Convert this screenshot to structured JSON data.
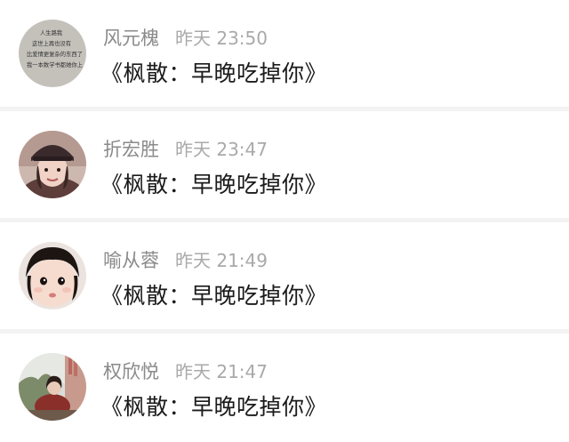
{
  "messages": [
    {
      "name": "风元槐",
      "time": "昨天 23:50",
      "text": "《枫散：早晚吃掉你》",
      "avatar": "text-image-avatar",
      "avatar_lines": [
        "人生路我",
        "这世上再也没有",
        "比爱情更复杂的东西了",
        "我一本数学书都她你上"
      ]
    },
    {
      "name": "折宏胜",
      "time": "昨天 23:47",
      "text": "《枫散：早晚吃掉你》",
      "avatar": "girl-with-cap-avatar"
    },
    {
      "name": "喻从蓉",
      "time": "昨天 21:49",
      "text": "《枫散：早晚吃掉你》",
      "avatar": "baby-face-avatar"
    },
    {
      "name": "权欣悦",
      "time": "昨天 21:47",
      "text": "《枫散：早晚吃掉你》",
      "avatar": "girl-outdoor-photo-avatar"
    }
  ]
}
